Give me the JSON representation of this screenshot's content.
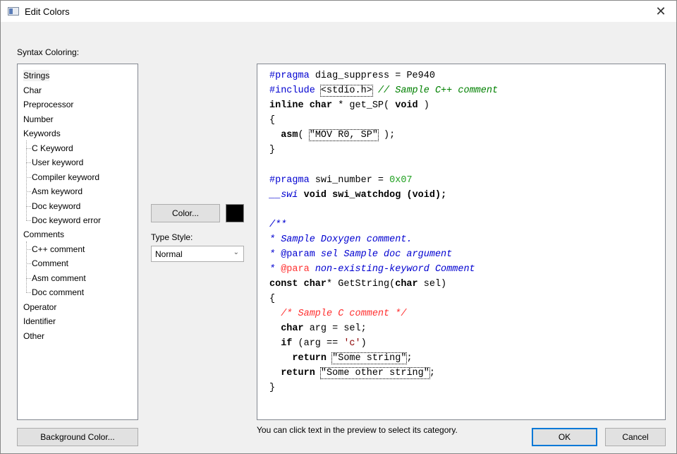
{
  "window": {
    "title": "Edit Colors",
    "close_label": "✕"
  },
  "labels": {
    "syntax_coloring": "Syntax Coloring:",
    "type_style": "Type Style:"
  },
  "tree": {
    "items": [
      {
        "label": "Strings"
      },
      {
        "label": "Char"
      },
      {
        "label": "Preprocessor"
      },
      {
        "label": "Number"
      },
      {
        "label": "Keywords"
      },
      {
        "label": "C Keyword"
      },
      {
        "label": "User keyword"
      },
      {
        "label": "Compiler keyword"
      },
      {
        "label": "Asm keyword"
      },
      {
        "label": "Doc keyword"
      },
      {
        "label": "Doc keyword error"
      },
      {
        "label": "Comments"
      },
      {
        "label": "C++ comment"
      },
      {
        "label": "Comment"
      },
      {
        "label": "Asm comment"
      },
      {
        "label": "Doc comment"
      },
      {
        "label": "Operator"
      },
      {
        "label": "Identifier"
      },
      {
        "label": "Other"
      }
    ],
    "selected": "Strings"
  },
  "buttons": {
    "color": "Color...",
    "background_color": "Background Color...",
    "ok": "OK",
    "cancel": "Cancel"
  },
  "color_swatch": "#000000",
  "type_style": {
    "value": "Normal"
  },
  "hint": "You can click text in the preview to select its category.",
  "code": {
    "l1a": "#pragma",
    "l1b": " diag_suppress = Pe940",
    "l2a": "#include",
    "l2b": "<stdio.h>",
    "l2c": " // Sample C++ comment",
    "l3a": "inline char",
    "l3b": " * get_SP( ",
    "l3c": "void",
    "l3d": " )",
    "l4": "{",
    "l5a": "  asm",
    "l5b": "( ",
    "l5c": "\"MOV R0, SP\"",
    "l5d": " );",
    "l6": "}",
    "l8a": "#pragma",
    "l8b": " swi_number = ",
    "l8c": "0x07",
    "l9a": "__swi",
    "l9b": " void",
    "l9c": " swi_watchdog (",
    "l9d": "void",
    "l9e": ");",
    "l11": "/**",
    "l12": "* Sample Doxygen comment.",
    "l13a": "* ",
    "l13b": "@param",
    "l13c": " sel Sample doc argument",
    "l14a": "* ",
    "l14b": "@para",
    "l14c": " non-existing-keyword Comment",
    "l15a": "const char",
    "l15b": "* GetString(",
    "l15c": "char",
    "l15d": " sel)",
    "l16": "{",
    "l17": "  /* Sample C comment */",
    "l18a": "  char",
    "l18b": " arg = sel;",
    "l19a": "  if",
    "l19b": " (arg == ",
    "l19c": "'c'",
    "l19d": ")",
    "l20a": "    return",
    "l20b": " ",
    "l20c": "\"Some string\"",
    "l20d": ";",
    "l21a": "  return",
    "l21b": " ",
    "l21c": "\"Some other string\"",
    "l21d": ";",
    "l22": "}"
  }
}
